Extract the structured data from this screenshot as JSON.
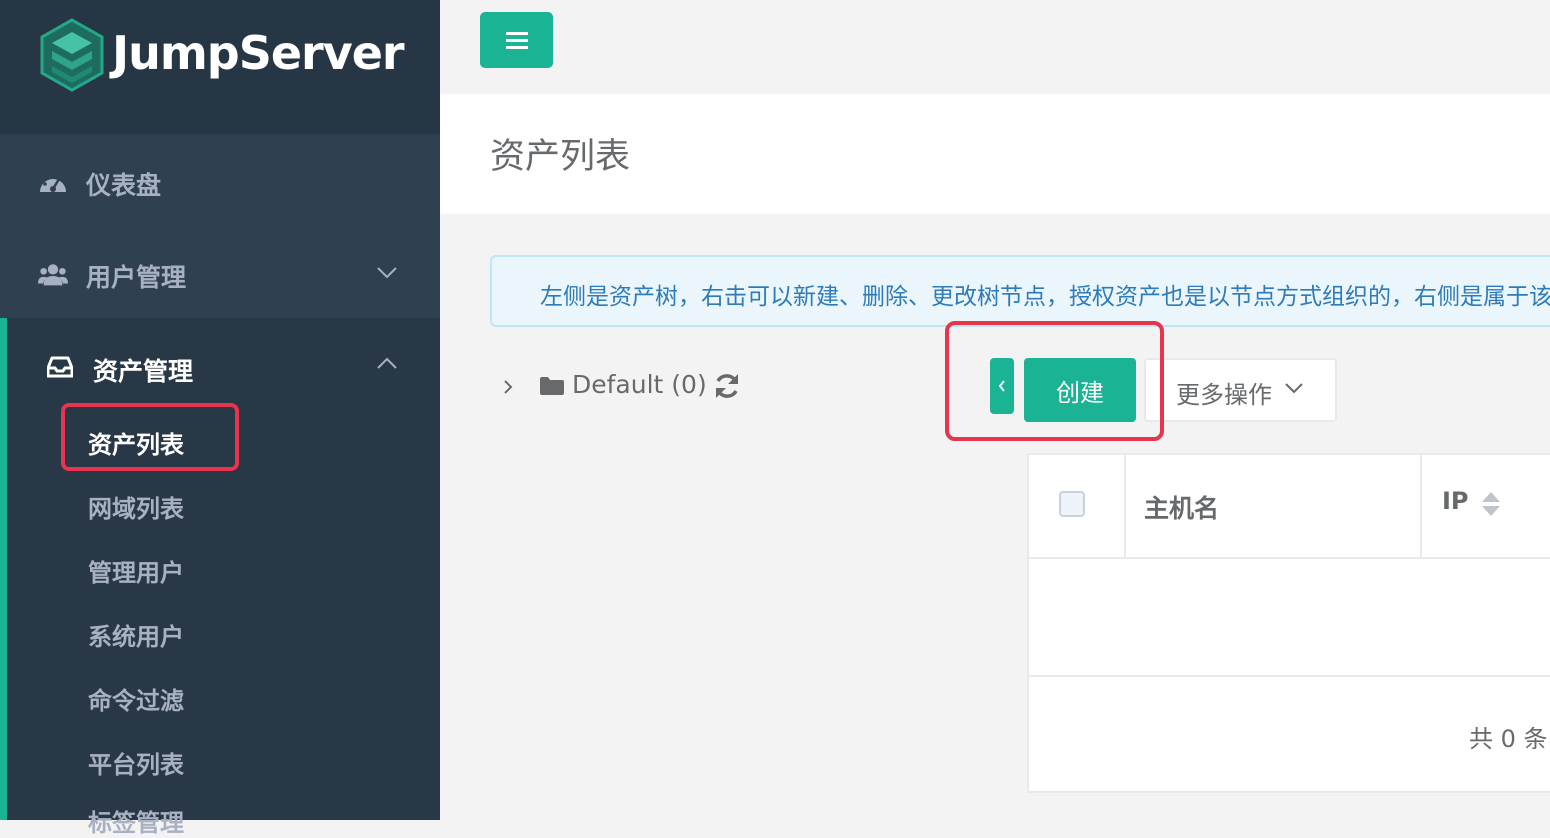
{
  "app": {
    "brand": "JumpServer",
    "accent_color": "#1ab394",
    "sidebar_bg": "#2f4050",
    "highlight_color": "#e8344c"
  },
  "sidebar": {
    "items": [
      {
        "label": "仪表盘",
        "icon": "dashboard-icon"
      },
      {
        "label": "用户管理",
        "icon": "users-icon"
      },
      {
        "label": "资产管理",
        "icon": "inbox-icon"
      }
    ],
    "submenu": [
      {
        "label": "资产列表",
        "active": true
      },
      {
        "label": "网域列表"
      },
      {
        "label": "管理用户"
      },
      {
        "label": "系统用户"
      },
      {
        "label": "命令过滤"
      },
      {
        "label": "平台列表"
      },
      {
        "label": "标签管理"
      }
    ]
  },
  "page": {
    "title": "资产列表",
    "alert": "左侧是资产树，右击可以新建、删除、更改树节点，授权资产也是以节点方式组织的，右侧是属于该节点下的资产"
  },
  "tree": {
    "root_label": "Default (0)"
  },
  "toolbar": {
    "create_label": "创建",
    "more_label": "更多操作"
  },
  "table": {
    "columns": [
      "主机名",
      "IP"
    ],
    "total": "共 0 条"
  }
}
